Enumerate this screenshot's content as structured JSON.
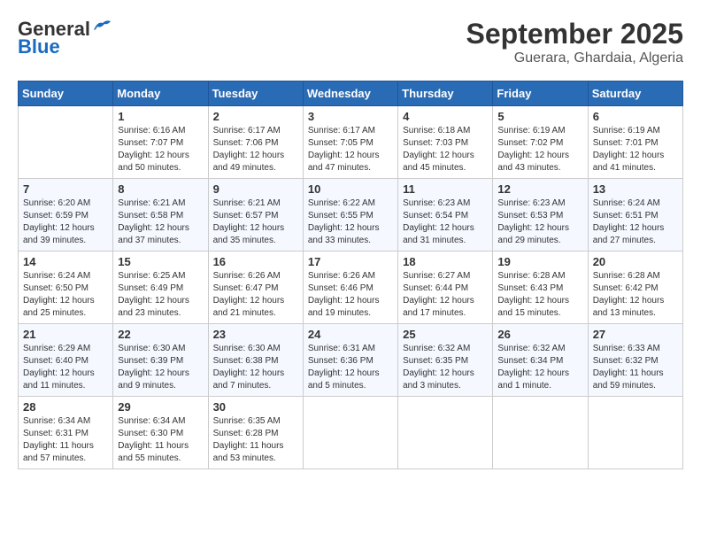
{
  "header": {
    "logo_line1": "General",
    "logo_line2": "Blue",
    "month_year": "September 2025",
    "location": "Guerara, Ghardaia, Algeria"
  },
  "days_of_week": [
    "Sunday",
    "Monday",
    "Tuesday",
    "Wednesday",
    "Thursday",
    "Friday",
    "Saturday"
  ],
  "weeks": [
    [
      {
        "day": "",
        "info": ""
      },
      {
        "day": "1",
        "info": "Sunrise: 6:16 AM\nSunset: 7:07 PM\nDaylight: 12 hours\nand 50 minutes."
      },
      {
        "day": "2",
        "info": "Sunrise: 6:17 AM\nSunset: 7:06 PM\nDaylight: 12 hours\nand 49 minutes."
      },
      {
        "day": "3",
        "info": "Sunrise: 6:17 AM\nSunset: 7:05 PM\nDaylight: 12 hours\nand 47 minutes."
      },
      {
        "day": "4",
        "info": "Sunrise: 6:18 AM\nSunset: 7:03 PM\nDaylight: 12 hours\nand 45 minutes."
      },
      {
        "day": "5",
        "info": "Sunrise: 6:19 AM\nSunset: 7:02 PM\nDaylight: 12 hours\nand 43 minutes."
      },
      {
        "day": "6",
        "info": "Sunrise: 6:19 AM\nSunset: 7:01 PM\nDaylight: 12 hours\nand 41 minutes."
      }
    ],
    [
      {
        "day": "7",
        "info": "Sunrise: 6:20 AM\nSunset: 6:59 PM\nDaylight: 12 hours\nand 39 minutes."
      },
      {
        "day": "8",
        "info": "Sunrise: 6:21 AM\nSunset: 6:58 PM\nDaylight: 12 hours\nand 37 minutes."
      },
      {
        "day": "9",
        "info": "Sunrise: 6:21 AM\nSunset: 6:57 PM\nDaylight: 12 hours\nand 35 minutes."
      },
      {
        "day": "10",
        "info": "Sunrise: 6:22 AM\nSunset: 6:55 PM\nDaylight: 12 hours\nand 33 minutes."
      },
      {
        "day": "11",
        "info": "Sunrise: 6:23 AM\nSunset: 6:54 PM\nDaylight: 12 hours\nand 31 minutes."
      },
      {
        "day": "12",
        "info": "Sunrise: 6:23 AM\nSunset: 6:53 PM\nDaylight: 12 hours\nand 29 minutes."
      },
      {
        "day": "13",
        "info": "Sunrise: 6:24 AM\nSunset: 6:51 PM\nDaylight: 12 hours\nand 27 minutes."
      }
    ],
    [
      {
        "day": "14",
        "info": "Sunrise: 6:24 AM\nSunset: 6:50 PM\nDaylight: 12 hours\nand 25 minutes."
      },
      {
        "day": "15",
        "info": "Sunrise: 6:25 AM\nSunset: 6:49 PM\nDaylight: 12 hours\nand 23 minutes."
      },
      {
        "day": "16",
        "info": "Sunrise: 6:26 AM\nSunset: 6:47 PM\nDaylight: 12 hours\nand 21 minutes."
      },
      {
        "day": "17",
        "info": "Sunrise: 6:26 AM\nSunset: 6:46 PM\nDaylight: 12 hours\nand 19 minutes."
      },
      {
        "day": "18",
        "info": "Sunrise: 6:27 AM\nSunset: 6:44 PM\nDaylight: 12 hours\nand 17 minutes."
      },
      {
        "day": "19",
        "info": "Sunrise: 6:28 AM\nSunset: 6:43 PM\nDaylight: 12 hours\nand 15 minutes."
      },
      {
        "day": "20",
        "info": "Sunrise: 6:28 AM\nSunset: 6:42 PM\nDaylight: 12 hours\nand 13 minutes."
      }
    ],
    [
      {
        "day": "21",
        "info": "Sunrise: 6:29 AM\nSunset: 6:40 PM\nDaylight: 12 hours\nand 11 minutes."
      },
      {
        "day": "22",
        "info": "Sunrise: 6:30 AM\nSunset: 6:39 PM\nDaylight: 12 hours\nand 9 minutes."
      },
      {
        "day": "23",
        "info": "Sunrise: 6:30 AM\nSunset: 6:38 PM\nDaylight: 12 hours\nand 7 minutes."
      },
      {
        "day": "24",
        "info": "Sunrise: 6:31 AM\nSunset: 6:36 PM\nDaylight: 12 hours\nand 5 minutes."
      },
      {
        "day": "25",
        "info": "Sunrise: 6:32 AM\nSunset: 6:35 PM\nDaylight: 12 hours\nand 3 minutes."
      },
      {
        "day": "26",
        "info": "Sunrise: 6:32 AM\nSunset: 6:34 PM\nDaylight: 12 hours\nand 1 minute."
      },
      {
        "day": "27",
        "info": "Sunrise: 6:33 AM\nSunset: 6:32 PM\nDaylight: 11 hours\nand 59 minutes."
      }
    ],
    [
      {
        "day": "28",
        "info": "Sunrise: 6:34 AM\nSunset: 6:31 PM\nDaylight: 11 hours\nand 57 minutes."
      },
      {
        "day": "29",
        "info": "Sunrise: 6:34 AM\nSunset: 6:30 PM\nDaylight: 11 hours\nand 55 minutes."
      },
      {
        "day": "30",
        "info": "Sunrise: 6:35 AM\nSunset: 6:28 PM\nDaylight: 11 hours\nand 53 minutes."
      },
      {
        "day": "",
        "info": ""
      },
      {
        "day": "",
        "info": ""
      },
      {
        "day": "",
        "info": ""
      },
      {
        "day": "",
        "info": ""
      }
    ]
  ]
}
